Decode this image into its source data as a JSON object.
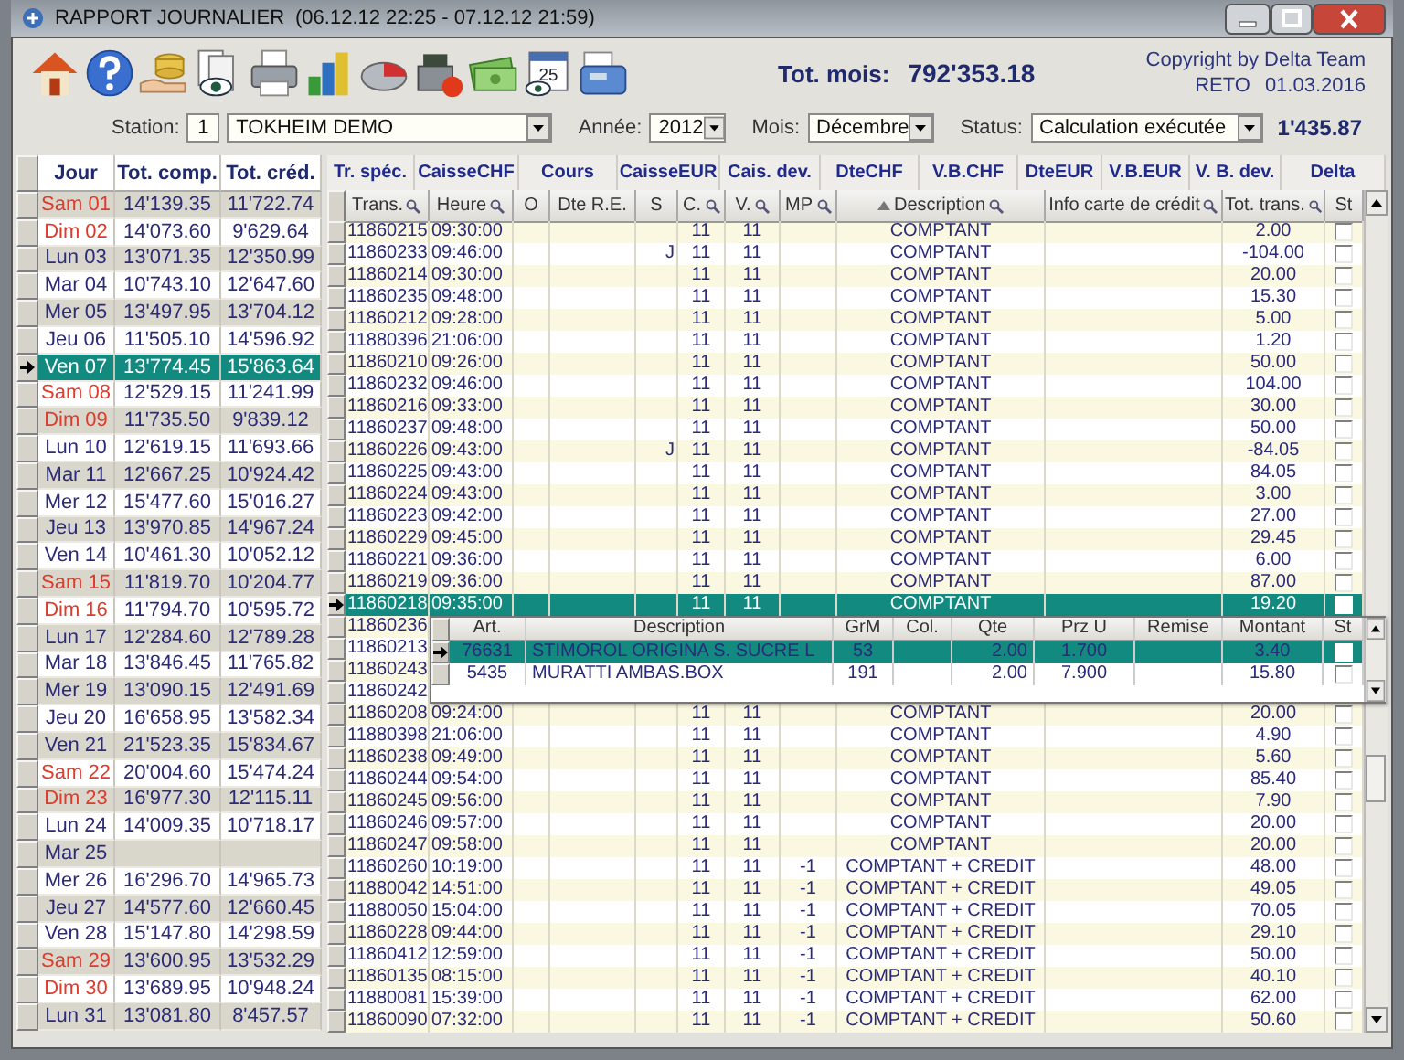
{
  "window": {
    "title": "RAPPORT JOURNALIER",
    "subtitle": "(06.12.12 22:25 - 07.12.12 21:59)"
  },
  "toolbar": {
    "calendar_day": "25"
  },
  "month_total": {
    "label": "Tot. mois:",
    "value": "792'353.18"
  },
  "copyright": "Copyright by Delta Team",
  "user_date": {
    "user": "RETO",
    "date": "01.03.2016"
  },
  "filters": {
    "station_label": "Station:",
    "station_number": "1",
    "station_name": "TOKHEIM DEMO",
    "year_label": "Année:",
    "year": "2012",
    "month_label": "Mois:",
    "month": "Décembre",
    "status_label": "Status:",
    "status": "Calculation exécutée",
    "total": "1'435.87"
  },
  "days": {
    "columns": [
      "Jour",
      "Tot. comp.",
      "Tot. créd."
    ],
    "rows": [
      {
        "day": "Sam 01",
        "comp": "14'139.35",
        "cred": "11'722.74",
        "weekend": true,
        "selected": false
      },
      {
        "day": "Dim 02",
        "comp": "14'073.60",
        "cred": "9'629.64",
        "weekend": true,
        "selected": false
      },
      {
        "day": "Lun 03",
        "comp": "13'071.35",
        "cred": "12'350.99",
        "weekend": false,
        "selected": false
      },
      {
        "day": "Mar 04",
        "comp": "10'743.10",
        "cred": "12'647.60",
        "weekend": false,
        "selected": false
      },
      {
        "day": "Mer 05",
        "comp": "13'497.95",
        "cred": "13'704.12",
        "weekend": false,
        "selected": false
      },
      {
        "day": "Jeu 06",
        "comp": "11'505.10",
        "cred": "14'596.92",
        "weekend": false,
        "selected": false
      },
      {
        "day": "Ven 07",
        "comp": "13'774.45",
        "cred": "15'863.64",
        "weekend": false,
        "selected": true
      },
      {
        "day": "Sam 08",
        "comp": "12'529.15",
        "cred": "11'241.99",
        "weekend": true,
        "selected": false
      },
      {
        "day": "Dim 09",
        "comp": "11'735.50",
        "cred": "9'839.12",
        "weekend": true,
        "selected": false
      },
      {
        "day": "Lun 10",
        "comp": "12'619.15",
        "cred": "11'693.66",
        "weekend": false,
        "selected": false
      },
      {
        "day": "Mar 11",
        "comp": "12'667.25",
        "cred": "10'924.42",
        "weekend": false,
        "selected": false
      },
      {
        "day": "Mer 12",
        "comp": "15'477.60",
        "cred": "15'016.27",
        "weekend": false,
        "selected": false
      },
      {
        "day": "Jeu 13",
        "comp": "13'970.85",
        "cred": "14'967.24",
        "weekend": false,
        "selected": false
      },
      {
        "day": "Ven 14",
        "comp": "10'461.30",
        "cred": "10'052.12",
        "weekend": false,
        "selected": false
      },
      {
        "day": "Sam 15",
        "comp": "11'819.70",
        "cred": "10'204.77",
        "weekend": true,
        "selected": false
      },
      {
        "day": "Dim 16",
        "comp": "11'794.70",
        "cred": "10'595.72",
        "weekend": true,
        "selected": false
      },
      {
        "day": "Lun 17",
        "comp": "12'284.60",
        "cred": "12'789.28",
        "weekend": false,
        "selected": false
      },
      {
        "day": "Mar 18",
        "comp": "13'846.45",
        "cred": "11'765.82",
        "weekend": false,
        "selected": false
      },
      {
        "day": "Mer 19",
        "comp": "13'090.15",
        "cred": "12'491.69",
        "weekend": false,
        "selected": false
      },
      {
        "day": "Jeu 20",
        "comp": "16'658.95",
        "cred": "13'582.34",
        "weekend": false,
        "selected": false
      },
      {
        "day": "Ven 21",
        "comp": "21'523.35",
        "cred": "15'834.67",
        "weekend": false,
        "selected": false
      },
      {
        "day": "Sam 22",
        "comp": "20'004.60",
        "cred": "15'474.24",
        "weekend": true,
        "selected": false
      },
      {
        "day": "Dim 23",
        "comp": "16'977.30",
        "cred": "12'115.11",
        "weekend": true,
        "selected": false
      },
      {
        "day": "Lun 24",
        "comp": "14'009.35",
        "cred": "10'718.17",
        "weekend": false,
        "selected": false
      },
      {
        "day": "Mar 25",
        "weekend": false,
        "selected": false
      },
      {
        "day": "Mer 26",
        "comp": "16'296.70",
        "cred": "14'965.73",
        "weekend": false,
        "selected": false
      },
      {
        "day": "Jeu 27",
        "comp": "14'577.60",
        "cred": "12'660.45",
        "weekend": false,
        "selected": false
      },
      {
        "day": "Ven 28",
        "comp": "15'147.80",
        "cred": "14'298.59",
        "weekend": false,
        "selected": false
      },
      {
        "day": "Sam 29",
        "comp": "13'600.95",
        "cred": "13'532.29",
        "weekend": true,
        "selected": false
      },
      {
        "day": "Dim 30",
        "comp": "13'689.95",
        "cred": "10'948.24",
        "weekend": true,
        "selected": false
      },
      {
        "day": "Lun 31",
        "comp": "13'081.80",
        "cred": "8'457.57",
        "weekend": false,
        "selected": false
      }
    ]
  },
  "groups": [
    "Tr. spéc.",
    "CaisseCHF",
    "Cours",
    "CaisseEUR",
    "Cais. dev.",
    "DteCHF",
    "V.B.CHF",
    "DteEUR",
    "V.B.EUR",
    "V. B. dev.",
    "Delta"
  ],
  "transactions": {
    "columns": [
      {
        "label": "Trans.",
        "filter": true,
        "sorted": false
      },
      {
        "label": "Heure",
        "filter": true,
        "sorted": false
      },
      {
        "label": "O",
        "filter": false,
        "sorted": false
      },
      {
        "label": "Dte R.E.",
        "filter": false,
        "sorted": false
      },
      {
        "label": "S",
        "filter": false,
        "sorted": false
      },
      {
        "label": "C.",
        "filter": true,
        "sorted": false
      },
      {
        "label": "V.",
        "filter": true,
        "sorted": false
      },
      {
        "label": "MP",
        "filter": true,
        "sorted": false
      },
      {
        "label": "Description",
        "filter": true,
        "sorted": true
      },
      {
        "label": "Info carte de crédit",
        "filter": true,
        "sorted": false
      },
      {
        "label": "Tot. trans.",
        "filter": true,
        "sorted": false
      },
      {
        "label": "St",
        "filter": false,
        "sorted": false
      }
    ],
    "rows": [
      {
        "trans": "11860215",
        "time": "09:30:00",
        "c": "11",
        "v": "11",
        "description": "COMPTANT",
        "total": "2.00",
        "checked": false,
        "selected": false
      },
      {
        "trans": "11860233",
        "time": "09:46:00",
        "s": "J",
        "c": "11",
        "v": "11",
        "description": "COMPTANT",
        "total": "-104.00",
        "checked": false,
        "selected": false
      },
      {
        "trans": "11860214",
        "time": "09:30:00",
        "c": "11",
        "v": "11",
        "description": "COMPTANT",
        "total": "20.00",
        "checked": false,
        "selected": false
      },
      {
        "trans": "11860235",
        "time": "09:48:00",
        "c": "11",
        "v": "11",
        "description": "COMPTANT",
        "total": "15.30",
        "checked": false,
        "selected": false
      },
      {
        "trans": "11860212",
        "time": "09:28:00",
        "c": "11",
        "v": "11",
        "description": "COMPTANT",
        "total": "5.00",
        "checked": false,
        "selected": false
      },
      {
        "trans": "11880396",
        "time": "21:06:00",
        "c": "11",
        "v": "11",
        "description": "COMPTANT",
        "total": "1.20",
        "checked": false,
        "selected": false
      },
      {
        "trans": "11860210",
        "time": "09:26:00",
        "c": "11",
        "v": "11",
        "description": "COMPTANT",
        "total": "50.00",
        "checked": false,
        "selected": false
      },
      {
        "trans": "11860232",
        "time": "09:46:00",
        "c": "11",
        "v": "11",
        "description": "COMPTANT",
        "total": "104.00",
        "checked": false,
        "selected": false
      },
      {
        "trans": "11860216",
        "time": "09:33:00",
        "c": "11",
        "v": "11",
        "description": "COMPTANT",
        "total": "30.00",
        "checked": false,
        "selected": false
      },
      {
        "trans": "11860237",
        "time": "09:48:00",
        "c": "11",
        "v": "11",
        "description": "COMPTANT",
        "total": "50.00",
        "checked": false,
        "selected": false
      },
      {
        "trans": "11860226",
        "time": "09:43:00",
        "s": "J",
        "c": "11",
        "v": "11",
        "description": "COMPTANT",
        "total": "-84.05",
        "checked": false,
        "selected": false
      },
      {
        "trans": "11860225",
        "time": "09:43:00",
        "c": "11",
        "v": "11",
        "description": "COMPTANT",
        "total": "84.05",
        "checked": false,
        "selected": false
      },
      {
        "trans": "11860224",
        "time": "09:43:00",
        "c": "11",
        "v": "11",
        "description": "COMPTANT",
        "total": "3.00",
        "checked": false,
        "selected": false
      },
      {
        "trans": "11860223",
        "time": "09:42:00",
        "c": "11",
        "v": "11",
        "description": "COMPTANT",
        "total": "27.00",
        "checked": false,
        "selected": false
      },
      {
        "trans": "11860229",
        "time": "09:45:00",
        "c": "11",
        "v": "11",
        "description": "COMPTANT",
        "total": "29.45",
        "checked": false,
        "selected": false
      },
      {
        "trans": "11860221",
        "time": "09:36:00",
        "c": "11",
        "v": "11",
        "description": "COMPTANT",
        "total": "6.00",
        "checked": false,
        "selected": false
      },
      {
        "trans": "11860219",
        "time": "09:36:00",
        "c": "11",
        "v": "11",
        "description": "COMPTANT",
        "total": "87.00",
        "checked": false,
        "selected": false
      },
      {
        "trans": "11860218",
        "time": "09:35:00",
        "c": "11",
        "v": "11",
        "description": "COMPTANT",
        "total": "19.20",
        "checked": false,
        "selected": true
      },
      {
        "trans": "11860236",
        "selected": false
      },
      {
        "trans": "11860213",
        "selected": false
      },
      {
        "trans": "11860243",
        "selected": false
      },
      {
        "trans": "11860242",
        "selected": false
      },
      {
        "trans": "11860208",
        "time": "09:24:00",
        "c": "11",
        "v": "11",
        "description": "COMPTANT",
        "total": "20.00",
        "checked": false,
        "selected": false
      },
      {
        "trans": "11880398",
        "time": "21:06:00",
        "c": "11",
        "v": "11",
        "description": "COMPTANT",
        "total": "4.90",
        "checked": false,
        "selected": false
      },
      {
        "trans": "11860238",
        "time": "09:49:00",
        "c": "11",
        "v": "11",
        "description": "COMPTANT",
        "total": "5.60",
        "checked": false,
        "selected": false
      },
      {
        "trans": "11860244",
        "time": "09:54:00",
        "c": "11",
        "v": "11",
        "description": "COMPTANT",
        "total": "85.40",
        "checked": false,
        "selected": false
      },
      {
        "trans": "11860245",
        "time": "09:56:00",
        "c": "11",
        "v": "11",
        "description": "COMPTANT",
        "total": "7.90",
        "checked": false,
        "selected": false
      },
      {
        "trans": "11860246",
        "time": "09:57:00",
        "c": "11",
        "v": "11",
        "description": "COMPTANT",
        "total": "20.00",
        "checked": false,
        "selected": false
      },
      {
        "trans": "11860247",
        "time": "09:58:00",
        "c": "11",
        "v": "11",
        "description": "COMPTANT",
        "total": "20.00",
        "checked": false,
        "selected": false
      },
      {
        "trans": "11860260",
        "time": "10:19:00",
        "c": "11",
        "v": "11",
        "mp": "-1",
        "description": "COMPTANT + CREDIT",
        "total": "48.00",
        "checked": false,
        "selected": false
      },
      {
        "trans": "11880042",
        "time": "14:51:00",
        "c": "11",
        "v": "11",
        "mp": "-1",
        "description": "COMPTANT + CREDIT",
        "total": "49.05",
        "checked": false,
        "selected": false
      },
      {
        "trans": "11880050",
        "time": "15:04:00",
        "c": "11",
        "v": "11",
        "mp": "-1",
        "description": "COMPTANT + CREDIT",
        "total": "70.05",
        "checked": false,
        "selected": false
      },
      {
        "trans": "11860228",
        "time": "09:44:00",
        "c": "11",
        "v": "11",
        "mp": "-1",
        "description": "COMPTANT + CREDIT",
        "total": "29.10",
        "checked": false,
        "selected": false
      },
      {
        "trans": "11860412",
        "time": "12:59:00",
        "c": "11",
        "v": "11",
        "mp": "-1",
        "description": "COMPTANT + CREDIT",
        "total": "50.00",
        "checked": false,
        "selected": false
      },
      {
        "trans": "11860135",
        "time": "08:15:00",
        "c": "11",
        "v": "11",
        "mp": "-1",
        "description": "COMPTANT + CREDIT",
        "total": "40.10",
        "checked": false,
        "selected": false
      },
      {
        "trans": "11880081",
        "time": "15:39:00",
        "c": "11",
        "v": "11",
        "mp": "-1",
        "description": "COMPTANT + CREDIT",
        "total": "62.00",
        "checked": false,
        "selected": false
      },
      {
        "trans": "11860090",
        "time": "07:32:00",
        "c": "11",
        "v": "11",
        "mp": "-1",
        "description": "COMPTANT + CREDIT",
        "total": "50.60",
        "checked": false,
        "selected": false
      }
    ]
  },
  "details": {
    "columns": [
      "Art.",
      "Description",
      "GrM",
      "Col.",
      "Qte",
      "Prz U",
      "Remise",
      "Montant",
      "St"
    ],
    "rows": [
      {
        "art": "76631",
        "description": "STIMOROL ORIGINA S. SUCRE L",
        "grm": "53",
        "qte": "2.00",
        "price": "1.700",
        "montant": "3.40",
        "checked": false,
        "selected": true
      },
      {
        "art": "5435",
        "description": "MURATTI AMBAS.BOX",
        "grm": "191",
        "qte": "2.00",
        "price": "7.900",
        "montant": "15.80",
        "checked": false,
        "selected": false
      }
    ]
  }
}
